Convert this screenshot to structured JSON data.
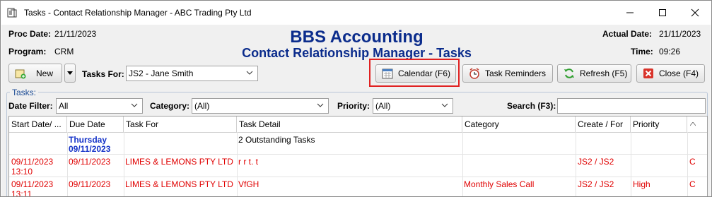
{
  "window": {
    "title": "Tasks - Contact Relationship Manager - ABC Trading Pty Ltd",
    "controls": [
      "minimize-icon",
      "maximize-icon",
      "close-icon"
    ]
  },
  "header": {
    "proc_date_label": "Proc Date:",
    "proc_date_value": "21/11/2023",
    "program_label": "Program:",
    "program_value": "CRM",
    "heading_main": "BBS Accounting",
    "heading_sub": "Contact Relationship Manager - Tasks",
    "actual_date_label": "Actual Date:",
    "actual_date_value": "21/11/2023",
    "time_label": "Time:",
    "time_value": "09:26"
  },
  "toolbar": {
    "new_label": "New",
    "tasks_for_label": "Tasks For:",
    "tasks_for_value": "JS2 - Jane Smith",
    "calendar_label": "Calendar (F6)",
    "reminders_label": "Task Reminders",
    "refresh_label": "Refresh (F5)",
    "close_label": "Close (F4)",
    "highlight_color": "#e02020"
  },
  "tasks_group": {
    "title": "Tasks:",
    "date_filter_label": "Date Filter:",
    "date_filter_value": "All",
    "category_label": "Category:",
    "category_value": "(All)",
    "priority_label": "Priority:",
    "priority_value": "(All)",
    "search_label": "Search (F3):",
    "search_value": ""
  },
  "grid": {
    "columns": [
      "Start Date/ ...",
      "Due Date",
      "Task For",
      "Task Detail",
      "Category",
      "Create / For",
      "Priority",
      ""
    ],
    "group_row": {
      "day": "Thursday",
      "date": "09/11/2023",
      "detail": "2 Outstanding Tasks"
    },
    "rows": [
      {
        "start_date": "09/11/2023",
        "start_time": "13:10",
        "due_date": "09/11/2023",
        "task_for": "LIMES & LEMONS PTY LTD",
        "detail": "r r t. t",
        "category": "",
        "create_for": "JS2 / JS2",
        "priority": "",
        "extra": "C"
      },
      {
        "start_date": "09/11/2023",
        "start_time": "13:11",
        "due_date": "09/11/2023",
        "task_for": "LIMES & LEMONS PTY LTD",
        "detail": "VfGH",
        "category": "Monthly Sales Call",
        "create_for": "JS2 / JS2",
        "priority": "High",
        "extra": "C"
      }
    ],
    "overdue_color": "#e00000",
    "group_color": "#1432c8"
  }
}
